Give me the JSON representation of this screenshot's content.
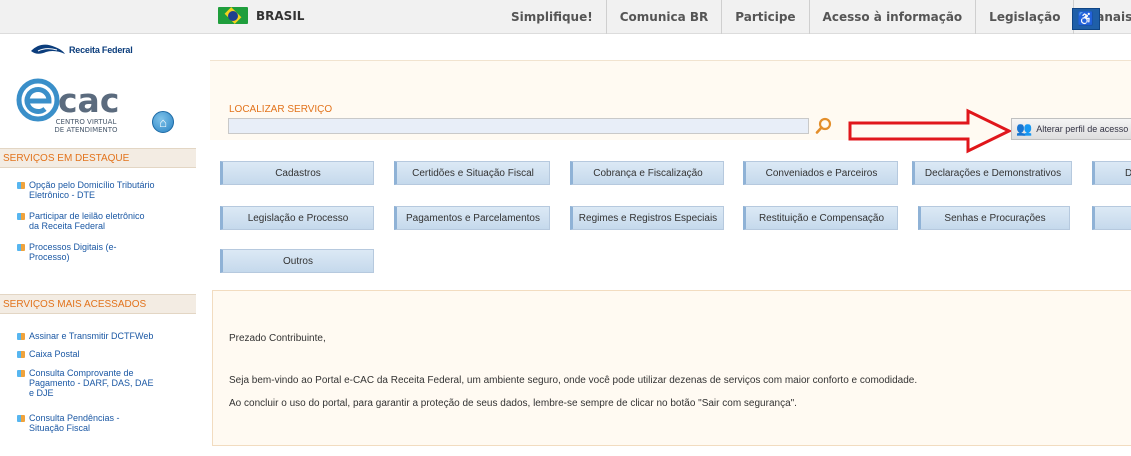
{
  "gov_bar": {
    "country_label": "BRASIL",
    "links": [
      "Simplifique!",
      "Comunica BR",
      "Participe",
      "Acesso à informação",
      "Legislação",
      "Canais"
    ]
  },
  "header": {
    "org_name": "Receita Federal",
    "ecac_logo": "cac",
    "ecac_sub1": "CENTRO VIRTUAL",
    "ecac_sub2": "DE ATENDIMENTO",
    "search_label": "LOCALIZAR SERVIÇO",
    "search_value": "",
    "profile_button": "Alterar perfil de acesso"
  },
  "sidebar": {
    "featured_title": "SERVIÇOS EM DESTAQUE",
    "featured": [
      {
        "line1": "Opção pelo Domicílio Tributário",
        "line2": "Eletrônico - DTE"
      },
      {
        "line1": "Participar de leilão eletrônico",
        "line2": "da Receita Federal"
      },
      {
        "line1": "Processos Digitais (e-",
        "line2": "Processo)"
      }
    ],
    "popular_title": "SERVIÇOS MAIS ACESSADOS",
    "popular": [
      {
        "line1": "Assinar e Transmitir DCTFWeb"
      },
      {
        "line1": "Caixa Postal"
      },
      {
        "line1": "Consulta Comprovante de",
        "line2": "Pagamento - DARF, DAS, DAE",
        "line3": "e DJE"
      },
      {
        "line1": "Consulta Pendências -",
        "line2": "Situação Fiscal"
      }
    ]
  },
  "services": {
    "row1": [
      "Cadastros",
      "Certidões e Situação Fiscal",
      "Cobrança e Fiscalização",
      "Conveniados e Parceiros",
      "Declarações e Demonstrativos",
      "D"
    ],
    "row2": [
      "Legislação e Processo",
      "Pagamentos e Parcelamentos",
      "Regimes e Registros Especiais",
      "Restituição e Compensação",
      "Senhas e Procurações",
      ""
    ],
    "row3": [
      "Outros"
    ]
  },
  "welcome": {
    "greeting": "Prezado Contribuinte,",
    "line1": "Seja bem-vindo ao Portal e-CAC da Receita Federal, um ambiente seguro, onde você pode utilizar dezenas de serviços com maior conforto e comodidade.",
    "line2": "Ao concluir o uso do portal, para garantir a proteção de seus dados, lembre-se sempre de clicar no botão \"Sair com segurança\"."
  },
  "colors": {
    "accent_orange": "#e2731c",
    "link_blue": "#1b58a4",
    "button_blue": "#c5d9ec",
    "arrow_red": "#e0161b"
  }
}
